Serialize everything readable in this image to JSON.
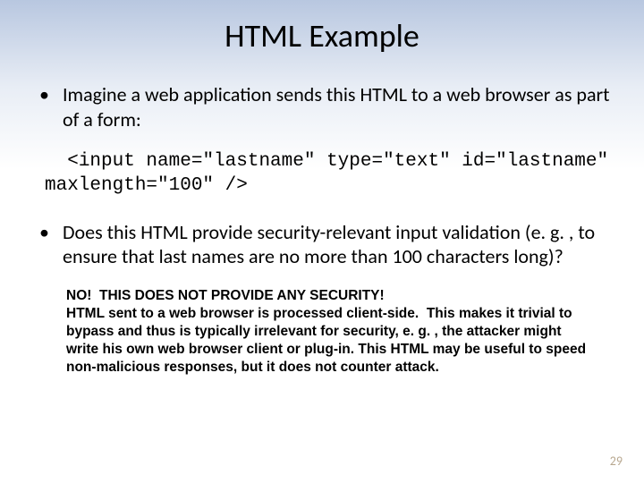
{
  "title": "HTML Example",
  "bullet1": "Imagine a web application sends this HTML to a web browser as part of a form:",
  "code": "  <input name=\"lastname\" type=\"text\" id=\"lastname\"\nmaxlength=\"100\" />",
  "bullet2": "Does this HTML provide security-relevant input validation (e. g. , to ensure that last names are no more than 100 characters long)?",
  "answer": "NO!  THIS DOES NOT PROVIDE ANY SECURITY!\nHTML sent to a web browser is processed client-side.  This makes it trivial to bypass and thus is typically irrelevant for security, e. g. , the attacker might write his own web browser client or plug-in. This HTML may be useful to speed non-malicious responses, but it does not counter attack.",
  "page_number": "29"
}
